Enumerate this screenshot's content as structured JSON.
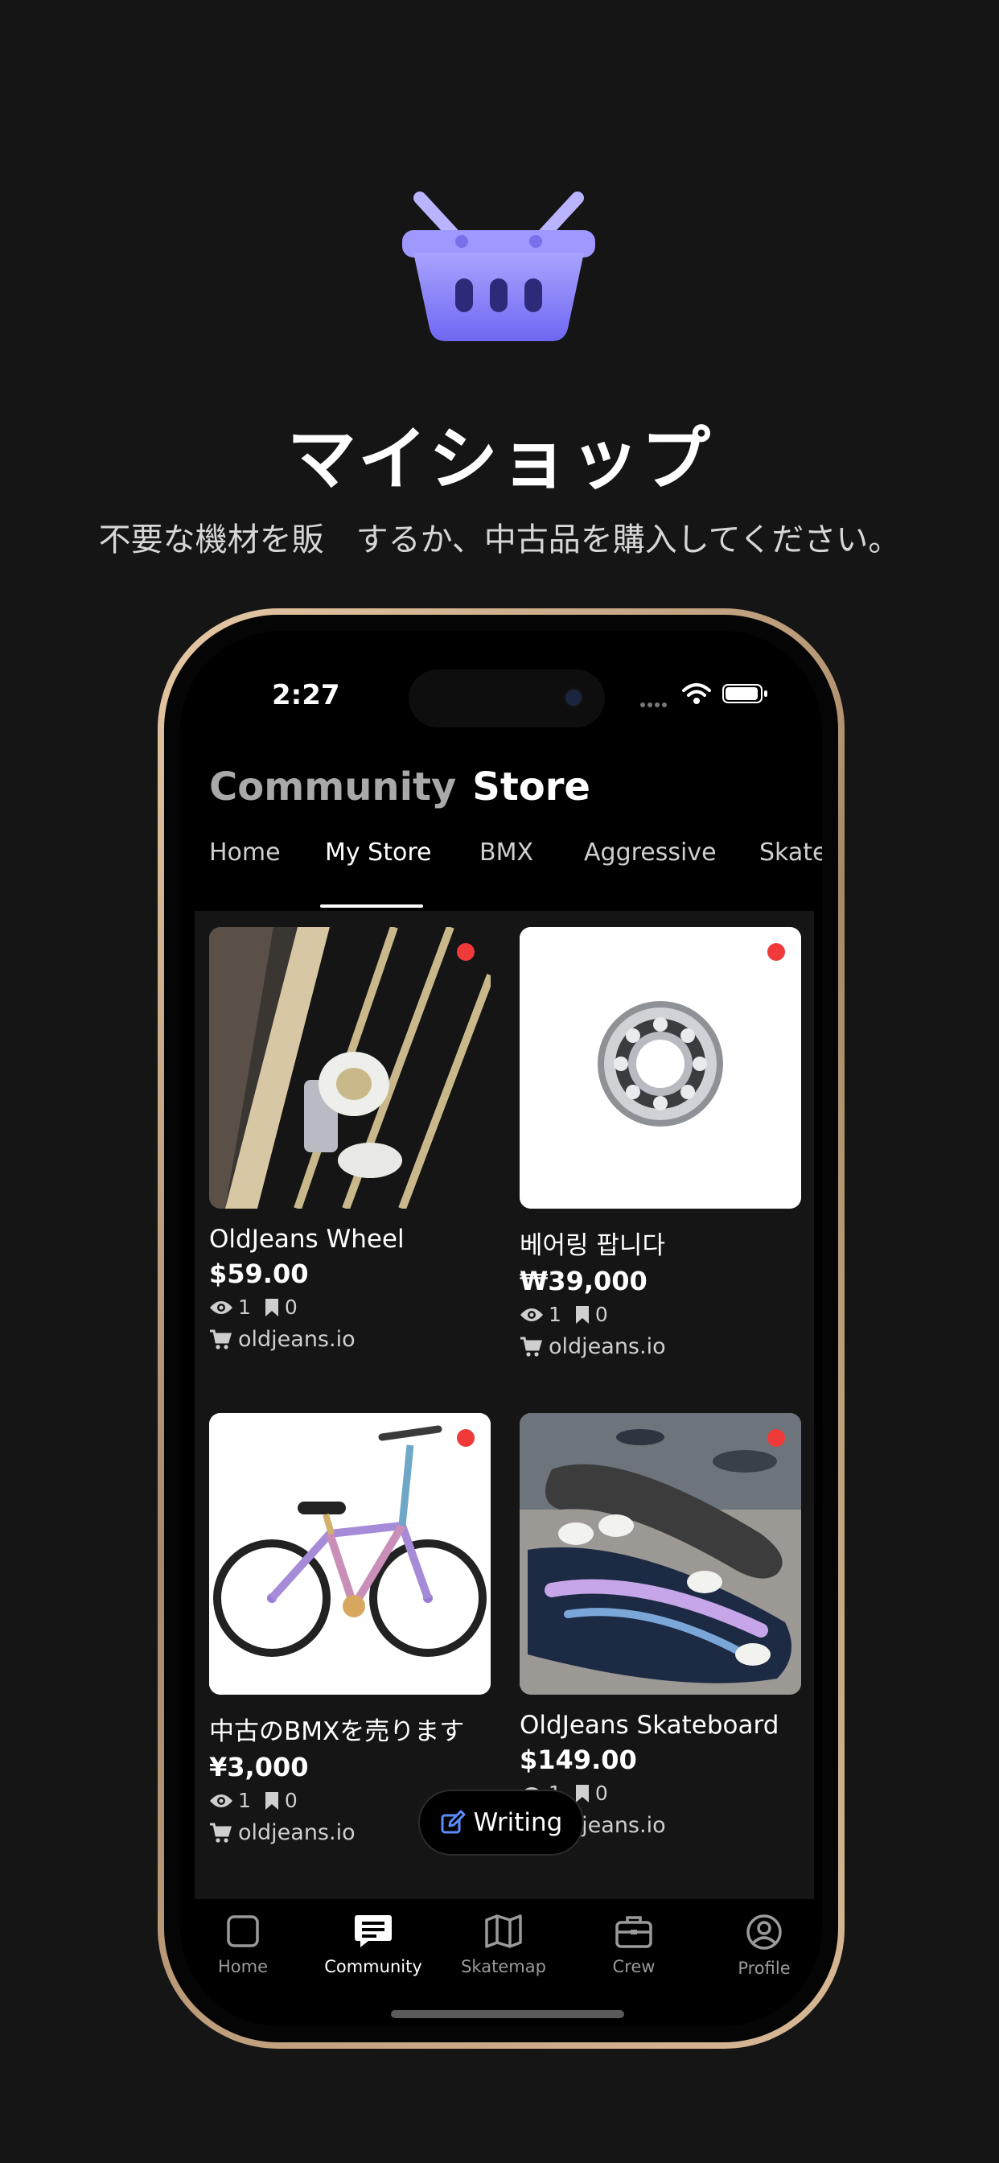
{
  "hero": {
    "icon": "shopping-basket-icon",
    "title": "マイショップ",
    "subtitle": "不要な機材を販　するか、中古品を購入してください。"
  },
  "status_bar": {
    "time": "2:27"
  },
  "app": {
    "title_inactive": "Community",
    "title_active": "Store",
    "tabs": [
      "Home",
      "My Store",
      "BMX",
      "Aggressive",
      "Skate"
    ],
    "active_tab": "My Store"
  },
  "items": [
    {
      "title": "OldJeans Wheel",
      "price": "$59.00",
      "views": "1",
      "bookmarks": "0",
      "store": "oldjeans.io",
      "image": "skateboard-wheel-photo"
    },
    {
      "title": "베어링 팝니다",
      "price": "₩39,000",
      "views": "1",
      "bookmarks": "0",
      "store": "oldjeans.io",
      "image": "ball-bearing-photo"
    },
    {
      "title": "中古のBMXを売ります",
      "price": "¥3,000",
      "views": "1",
      "bookmarks": "0",
      "store": "oldjeans.io",
      "image": "bmx-bike-photo"
    },
    {
      "title": "OldJeans Skateboard",
      "price": "$149.00",
      "views": "1",
      "bookmarks": "0",
      "store": "oldjeans.io",
      "image": "skateboard-photo"
    }
  ],
  "writing_button": {
    "label": "Writing",
    "icon": "edit-icon"
  },
  "nav": [
    {
      "label": "Home",
      "icon": "square-icon"
    },
    {
      "label": "Community",
      "icon": "chat-icon"
    },
    {
      "label": "Skatemap",
      "icon": "map-icon"
    },
    {
      "label": "Crew",
      "icon": "briefcase-icon"
    },
    {
      "label": "Profile",
      "icon": "profile-icon"
    }
  ],
  "colors": {
    "accent_basket": "#8c86ff",
    "background": "#151515",
    "badge": "#f03a3a",
    "writing_icon": "#5b8cff"
  }
}
